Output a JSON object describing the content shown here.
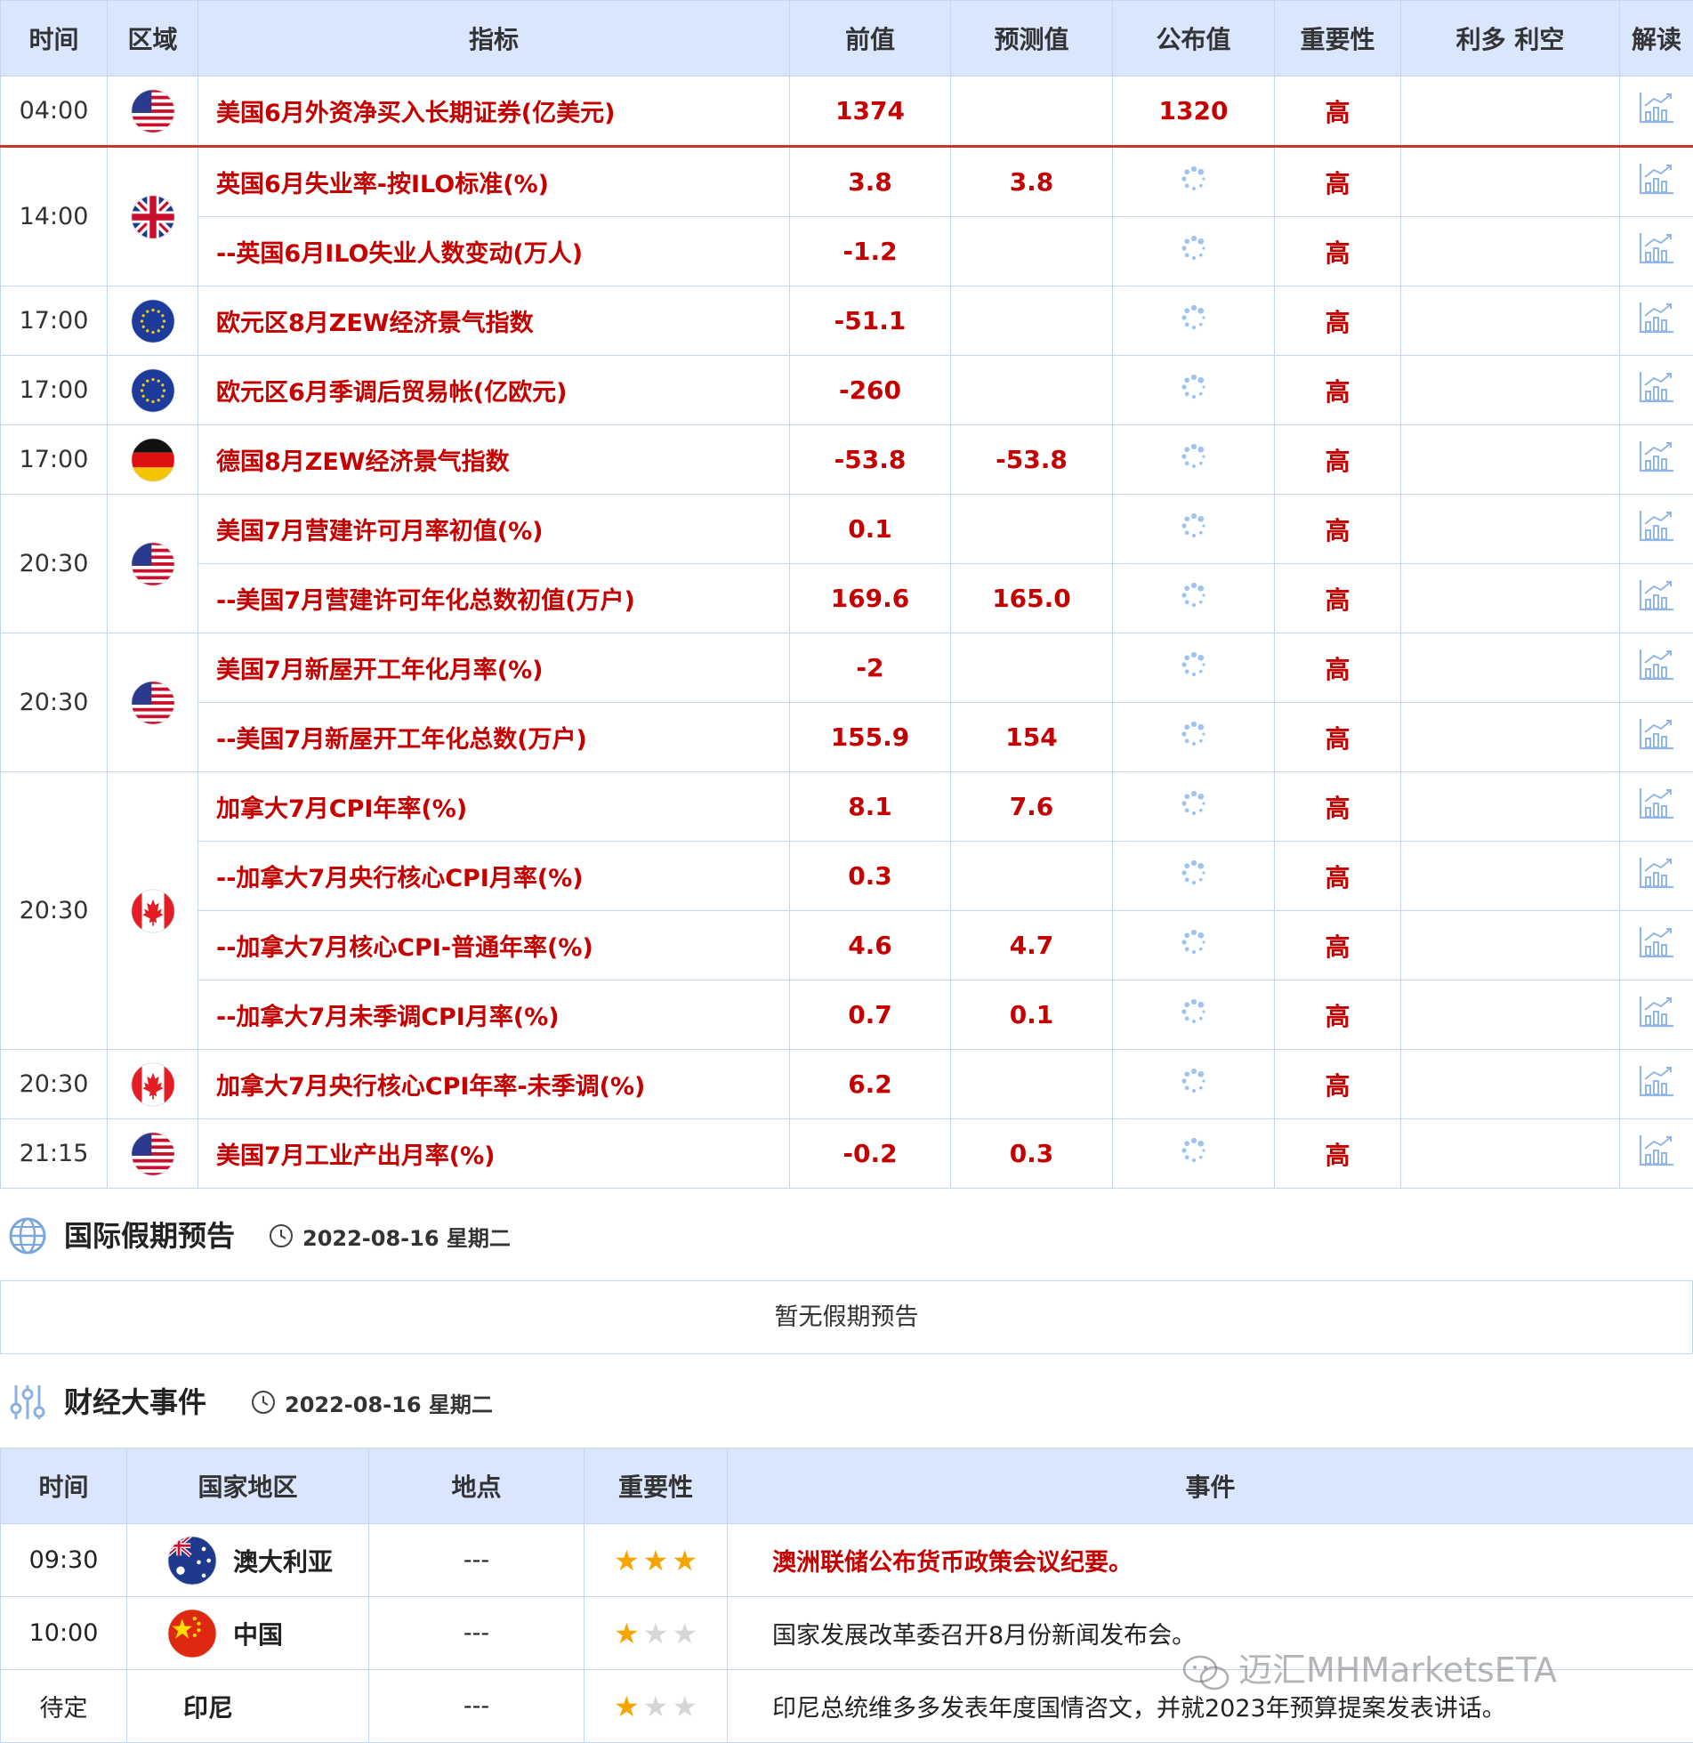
{
  "eco": {
    "headers": [
      "时间",
      "区域",
      "指标",
      "前值",
      "预测值",
      "公布值",
      "重要性",
      "利多 利空",
      "解读"
    ],
    "groups": [
      {
        "time": "04:00",
        "flag": "us",
        "first": true,
        "rows": [
          {
            "name": "美国6月外资净买入长期证券(亿美元)",
            "prev": "1374",
            "fc": "",
            "act": "1320",
            "imp": "高"
          }
        ]
      },
      {
        "time": "14:00",
        "flag": "uk",
        "rows": [
          {
            "name": "英国6月失业率-按ILO标准(%)",
            "prev": "3.8",
            "fc": "3.8",
            "act": "",
            "imp": "高"
          },
          {
            "name": "--英国6月ILO失业人数变动(万人)",
            "prev": "-1.2",
            "fc": "",
            "act": "",
            "imp": "高"
          }
        ]
      },
      {
        "time": "17:00",
        "flag": "eu",
        "rows": [
          {
            "name": "欧元区8月ZEW经济景气指数",
            "prev": "-51.1",
            "fc": "",
            "act": "",
            "imp": "高"
          }
        ]
      },
      {
        "time": "17:00",
        "flag": "eu",
        "rows": [
          {
            "name": "欧元区6月季调后贸易帐(亿欧元)",
            "prev": "-260",
            "fc": "",
            "act": "",
            "imp": "高"
          }
        ]
      },
      {
        "time": "17:00",
        "flag": "de",
        "rows": [
          {
            "name": "德国8月ZEW经济景气指数",
            "prev": "-53.8",
            "fc": "-53.8",
            "act": "",
            "imp": "高"
          }
        ]
      },
      {
        "time": "20:30",
        "flag": "us",
        "rows": [
          {
            "name": "美国7月营建许可月率初值(%)",
            "prev": "0.1",
            "fc": "",
            "act": "",
            "imp": "高"
          },
          {
            "name": "--美国7月营建许可年化总数初值(万户)",
            "prev": "169.6",
            "fc": "165.0",
            "act": "",
            "imp": "高"
          }
        ]
      },
      {
        "time": "20:30",
        "flag": "us",
        "rows": [
          {
            "name": "美国7月新屋开工年化月率(%)",
            "prev": "-2",
            "fc": "",
            "act": "",
            "imp": "高"
          },
          {
            "name": "--美国7月新屋开工年化总数(万户)",
            "prev": "155.9",
            "fc": "154",
            "act": "",
            "imp": "高"
          }
        ]
      },
      {
        "time": "20:30",
        "flag": "ca",
        "rows": [
          {
            "name": "加拿大7月CPI年率(%)",
            "prev": "8.1",
            "fc": "7.6",
            "act": "",
            "imp": "高"
          },
          {
            "name": "--加拿大7月央行核心CPI月率(%)",
            "prev": "0.3",
            "fc": "",
            "act": "",
            "imp": "高"
          },
          {
            "name": "--加拿大7月核心CPI-普通年率(%)",
            "prev": "4.6",
            "fc": "4.7",
            "act": "",
            "imp": "高"
          },
          {
            "name": "--加拿大7月未季调CPI月率(%)",
            "prev": "0.7",
            "fc": "0.1",
            "act": "",
            "imp": "高"
          }
        ]
      },
      {
        "time": "20:30",
        "flag": "ca",
        "rows": [
          {
            "name": "加拿大7月央行核心CPI年率-未季调(%)",
            "prev": "6.2",
            "fc": "",
            "act": "",
            "imp": "高"
          }
        ]
      },
      {
        "time": "21:15",
        "flag": "us",
        "rows": [
          {
            "name": "美国7月工业产出月率(%)",
            "prev": "-0.2",
            "fc": "0.3",
            "act": "",
            "imp": "高"
          }
        ]
      }
    ]
  },
  "holiday": {
    "title": "国际假期预告",
    "date": "2022-08-16 星期二",
    "empty": "暂无假期预告",
    "icon": "globe-icon"
  },
  "events": {
    "title": "财经大事件",
    "date": "2022-08-16 星期二",
    "icon": "sliders-icon",
    "headers": [
      "时间",
      "国家地区",
      "地点",
      "重要性",
      "事件"
    ],
    "rows": [
      {
        "time": "09:30",
        "flag": "au",
        "country": "澳大利亚",
        "place": "---",
        "stars": 3,
        "event": "澳洲联储公布货币政策会议纪要。",
        "highlight": true
      },
      {
        "time": "10:00",
        "flag": "cn",
        "country": "中国",
        "place": "---",
        "stars": 1,
        "event": "国家发展改革委召开8月份新闻发布会。",
        "highlight": false
      },
      {
        "time": "待定",
        "flag": "",
        "country": "印尼",
        "place": "---",
        "stars": 1,
        "event": "印尼总统维多多发表年度国情咨文，并就2023年预算提案发表讲话。",
        "highlight": false
      }
    ]
  },
  "watermark": "迈汇MHMarketsETA",
  "colors": {
    "accent_red": "#c40000",
    "header_bg": "#d9e6fd",
    "star_on": "#f6a400",
    "border": "#c6d6f0"
  }
}
